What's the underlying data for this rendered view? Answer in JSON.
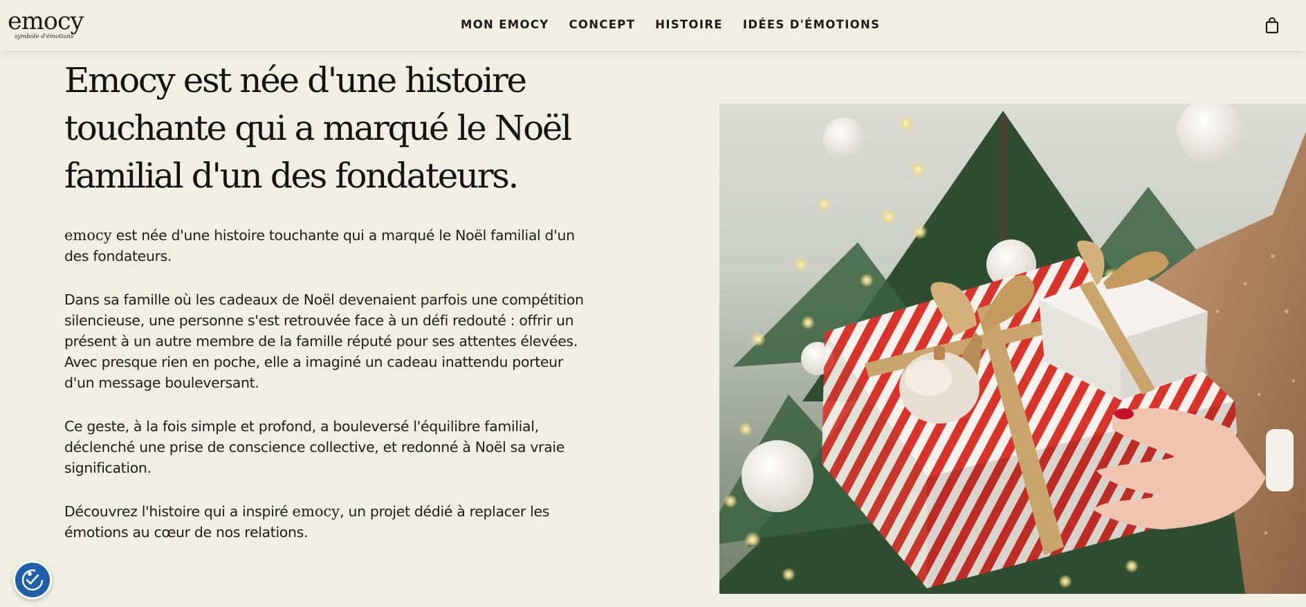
{
  "header": {
    "logo": {
      "wordmark": "emocy",
      "tagline": "symbole d'émotions"
    },
    "nav": [
      {
        "label": "MON EMOCY"
      },
      {
        "label": "CONCEPT"
      },
      {
        "label": "HISTOIRE"
      },
      {
        "label": "IDÉES D'ÉMOTIONS"
      }
    ],
    "cart_icon": "shopping-bag-icon"
  },
  "main": {
    "heading_lines": [
      "Emocy est née d'une histoire",
      "touchante qui a marqué le Noël",
      "familial d'un des fondateurs."
    ],
    "paragraphs": {
      "p1": {
        "brand": "emocy",
        "text": " est née d'une histoire touchante qui a marqué le Noël familial d'un des fondateurs."
      },
      "p2a": "Dans sa famille où les cadeaux de Noël devenaient parfois une compétition silencieuse, une personne s'est retrouvée face à un défi redouté : offrir un présent à un autre membre de la famille réputé pour ses attentes élevées.",
      "p2b": "Avec presque rien en poche, elle a imaginé un cadeau inattendu porteur d'un message bouleversant.",
      "p3": "Ce geste, à la fois simple et profond, a bouleversé l'équilibre familial, déclenché une prise de conscience collective, et redonné à Noël sa vraie signification.",
      "p4": {
        "before": "Découvrez l'histoire qui a inspiré ",
        "brand": "emocy",
        "after": ", un projet dédié à replacer les émotions au cœur de nos relations."
      }
    },
    "image": {
      "subject": "christmas-gift-photo"
    }
  },
  "accessibility_button": {
    "icon": "accessibility-icon"
  },
  "colors": {
    "background": "#f1efe3",
    "text": "#1b1b1b",
    "accessibility_blue": "#1f5ea8",
    "gift_red": "#d8342c",
    "ribbon_gold": "#c9a46c",
    "tree_green": "#2c4a30"
  }
}
